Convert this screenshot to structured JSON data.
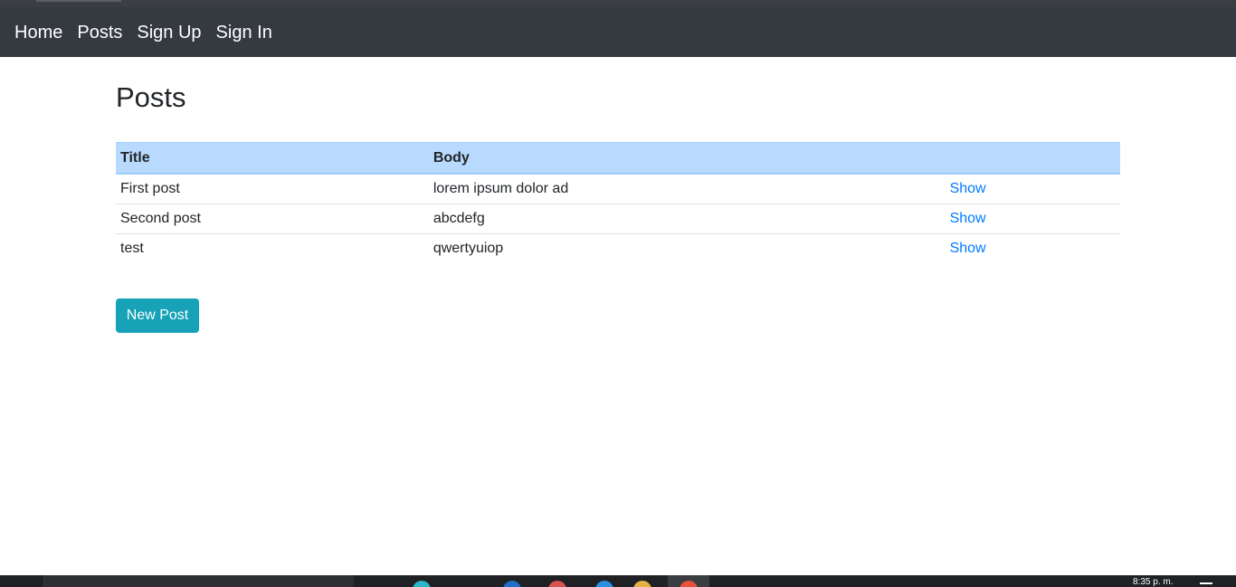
{
  "nav": {
    "items": [
      {
        "label": "Home"
      },
      {
        "label": "Posts"
      },
      {
        "label": "Sign Up"
      },
      {
        "label": "Sign In"
      }
    ]
  },
  "page": {
    "title": "Posts"
  },
  "table": {
    "headers": {
      "title": "Title",
      "body": "Body",
      "action": ""
    },
    "rows": [
      {
        "title": "First post",
        "body": "lorem ipsum dolor ad",
        "action": "Show"
      },
      {
        "title": "Second post",
        "body": "abcdefg",
        "action": "Show"
      },
      {
        "title": "test",
        "body": "qwertyuiop",
        "action": "Show"
      }
    ]
  },
  "actions": {
    "new_post_label": "New Post"
  },
  "taskbar": {
    "clock": "8:35 p. m."
  },
  "colors": {
    "navbar": "#343a40",
    "table_header": "#b8daff",
    "link": "#007bff",
    "button": "#17a2b8"
  }
}
